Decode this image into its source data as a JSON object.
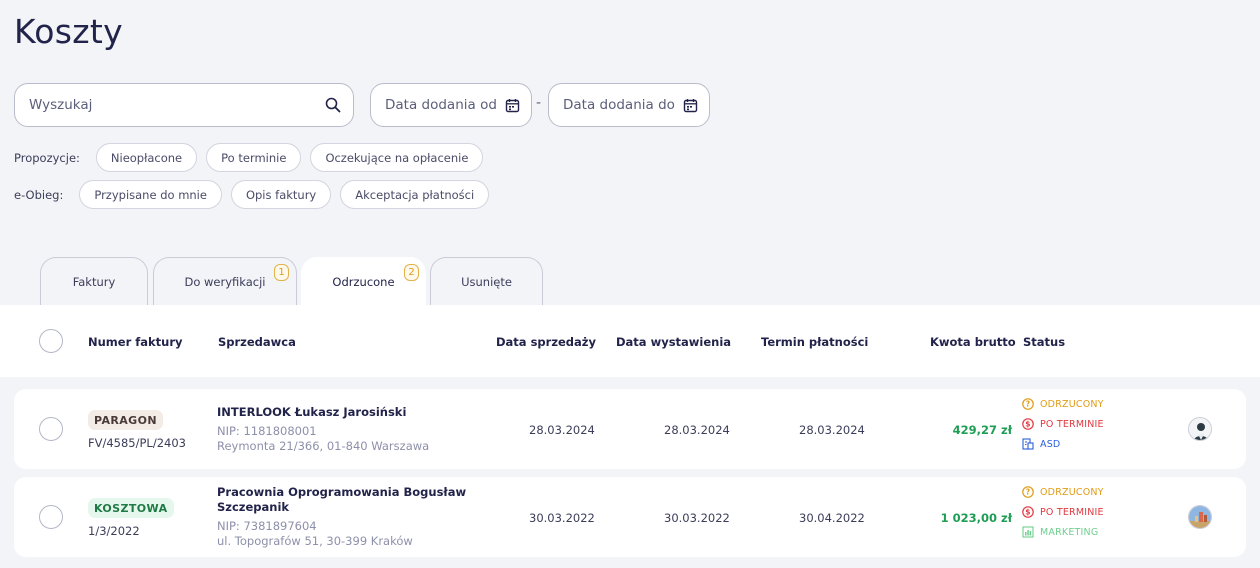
{
  "page": {
    "title": "Koszty"
  },
  "search": {
    "placeholder": "Wyszukaj"
  },
  "date_filter": {
    "from_label": "Data dodania od",
    "to_label": "Data dodania do",
    "separator": "-"
  },
  "suggestions": {
    "label": "Propozycje:",
    "chips": [
      "Nieopłacone",
      "Po terminie",
      "Oczekujące na opłacenie"
    ]
  },
  "eobieg": {
    "label": "e-Obieg:",
    "chips": [
      "Przypisane do mnie",
      "Opis faktury",
      "Akceptacja płatności"
    ]
  },
  "tabs": [
    {
      "label": "Faktury",
      "badge": ""
    },
    {
      "label": "Do weryfikacji",
      "badge": "1"
    },
    {
      "label": "Odrzucone",
      "badge": "2",
      "active": true
    },
    {
      "label": "Usunięte",
      "badge": ""
    }
  ],
  "table": {
    "columns": [
      "Numer faktury",
      "Sprzedawca",
      "Data sprzedaży",
      "Data wystawienia",
      "Termin płatności",
      "Kwota brutto",
      "Status"
    ],
    "rows": [
      {
        "doc_type": "PARAGON",
        "number": "FV/4585/PL/2403",
        "seller_name": "INTERLOOK Łukasz Jarosiński",
        "nip": "NIP: 1181808001",
        "address": "Reymonta 21/366, 01-840 Warszawa",
        "sale_date": "28.03.2024",
        "issue_date": "28.03.2024",
        "due_date": "28.03.2024",
        "amount": "429,27 zł",
        "statuses": [
          "ODRZUCONY",
          "PO TERMINIE",
          "ASD"
        ]
      },
      {
        "doc_type": "KOSZTOWA",
        "number": "1/3/2022",
        "seller_name": "Pracownia Oprogramowania Bogusław Szczepanik",
        "nip": "NIP: 7381897604",
        "address": "ul. Topografów 51, 30-399 Kraków",
        "sale_date": "30.03.2022",
        "issue_date": "30.03.2022",
        "due_date": "30.04.2022",
        "amount": "1 023,00 zł",
        "statuses": [
          "ODRZUCONY",
          "PO TERMINIE",
          "MARKETING"
        ]
      }
    ]
  },
  "colors": {
    "status_rejected": "#e19b13",
    "status_overdue": "#e0383e",
    "tag_asd": "#2b5fd9",
    "tag_marketing": "#6fcf8e",
    "amount": "#1e9e55"
  }
}
